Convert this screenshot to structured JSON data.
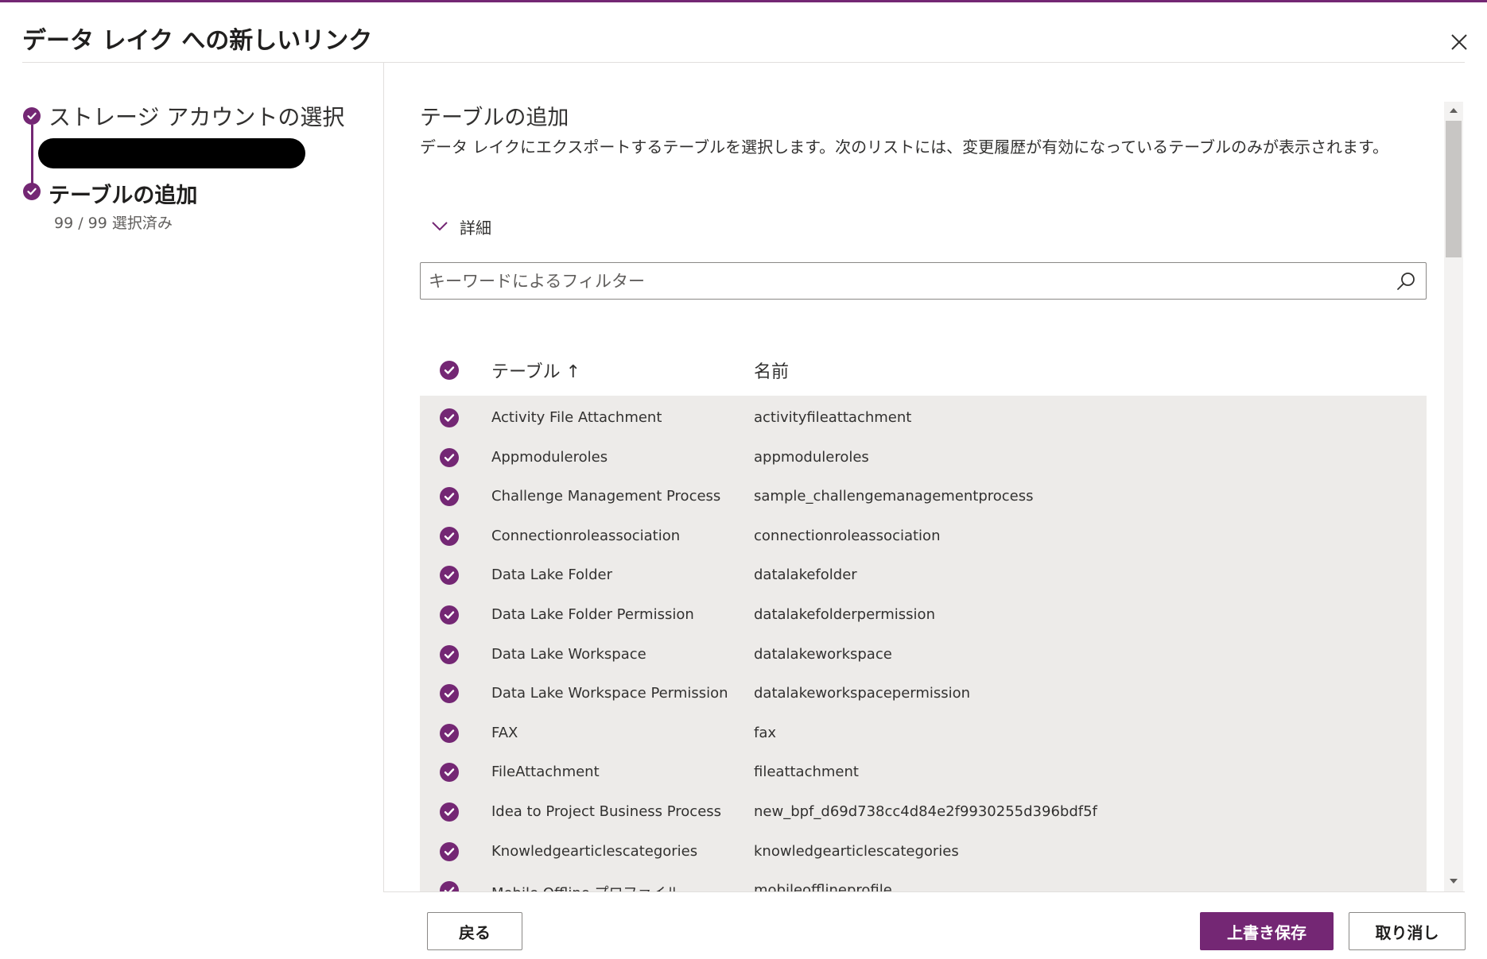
{
  "dialog": {
    "title": "データ レイク への新しいリンク",
    "close_icon": "close-icon"
  },
  "steps": [
    {
      "label": "ストレージ アカウントの選択",
      "completed": true
    },
    {
      "label": "テーブルの追加",
      "subtext": "99 / 99 選択済み",
      "current": true
    }
  ],
  "main": {
    "title": "テーブルの追加",
    "description": "データ レイクにエクスポートするテーブルを選択します。次のリストには、変更履歴が有効になっているテーブルのみが表示されます。",
    "details_label": "詳細",
    "filter_placeholder": "キーワードによるフィルター"
  },
  "table": {
    "headers": {
      "table": "テーブル ↑",
      "name": "名前"
    },
    "all_selected": true,
    "rows": [
      {
        "table": "Activity File Attachment",
        "name": "activityfileattachment"
      },
      {
        "table": "Appmoduleroles",
        "name": "appmoduleroles"
      },
      {
        "table": "Challenge Management Process",
        "name": "sample_challengemanagementprocess"
      },
      {
        "table": "Connectionroleassociation",
        "name": "connectionroleassociation"
      },
      {
        "table": "Data Lake Folder",
        "name": "datalakefolder"
      },
      {
        "table": "Data Lake Folder Permission",
        "name": "datalakefolderpermission"
      },
      {
        "table": "Data Lake Workspace",
        "name": "datalakeworkspace"
      },
      {
        "table": "Data Lake Workspace Permission",
        "name": "datalakeworkspacepermission"
      },
      {
        "table": "FAX",
        "name": "fax"
      },
      {
        "table": "FileAttachment",
        "name": "fileattachment"
      },
      {
        "table": "Idea to Project Business Process",
        "name": "new_bpf_d69d738cc4d84e2f9930255d396bdf5f"
      },
      {
        "table": "Knowledgearticlescategories",
        "name": "knowledgearticlescategories"
      },
      {
        "table": "Mobile Offline プロファイル",
        "name": "mobileofflineprofile"
      }
    ]
  },
  "footer": {
    "back_label": "戻る",
    "save_label": "上書き保存",
    "cancel_label": "取り消し"
  },
  "colors": {
    "accent": "#742774",
    "row_background": "#edebe9",
    "text": "#323130"
  }
}
